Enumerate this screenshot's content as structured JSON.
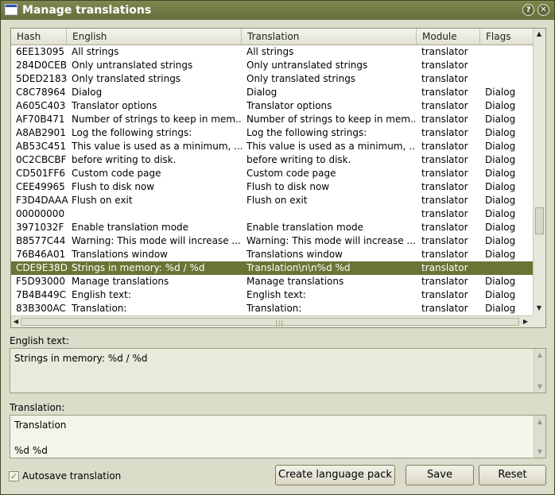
{
  "window": {
    "title": "Manage translations",
    "help_glyph": "?",
    "close_glyph": "✕"
  },
  "table": {
    "headers": [
      "Hash",
      "English",
      "Translation",
      "Module",
      "Flags"
    ],
    "rows": [
      {
        "hash": "6EE13095",
        "english": "All strings",
        "translation": "All strings",
        "module": "translator",
        "flags": ""
      },
      {
        "hash": "284D0CEB",
        "english": "Only untranslated strings",
        "translation": "Only untranslated strings",
        "module": "translator",
        "flags": ""
      },
      {
        "hash": "5DED2183",
        "english": "Only translated strings",
        "translation": "Only translated strings",
        "module": "translator",
        "flags": ""
      },
      {
        "hash": "C8C78964",
        "english": "Dialog",
        "translation": "Dialog",
        "module": "translator",
        "flags": "Dialog"
      },
      {
        "hash": "A605C403",
        "english": "Translator options",
        "translation": "Translator options",
        "module": "translator",
        "flags": "Dialog"
      },
      {
        "hash": "AF70B471",
        "english": "Number of strings to keep in mem...",
        "translation": "Number of strings to keep in mem...",
        "module": "translator",
        "flags": "Dialog"
      },
      {
        "hash": "A8AB2901",
        "english": "Log the following strings:",
        "translation": "Log the following strings:",
        "module": "translator",
        "flags": "Dialog"
      },
      {
        "hash": "AB53C451",
        "english": "This value is used as a minimum, ...",
        "translation": "This value is used as a minimum, ...",
        "module": "translator",
        "flags": "Dialog"
      },
      {
        "hash": "0C2CBCBF",
        "english": "before writing to disk.",
        "translation": "before writing to disk.",
        "module": "translator",
        "flags": "Dialog"
      },
      {
        "hash": "CD501FF6",
        "english": "Custom code page",
        "translation": "Custom code page",
        "module": "translator",
        "flags": "Dialog"
      },
      {
        "hash": "CEE49965",
        "english": "Flush to disk now",
        "translation": "Flush to disk now",
        "module": "translator",
        "flags": "Dialog"
      },
      {
        "hash": "F3D4DAAA",
        "english": "Flush on exit",
        "translation": "Flush on exit",
        "module": "translator",
        "flags": "Dialog"
      },
      {
        "hash": "00000000",
        "english": "",
        "translation": "",
        "module": "translator",
        "flags": "Dialog"
      },
      {
        "hash": "3971032F",
        "english": "Enable translation mode",
        "translation": "Enable translation mode",
        "module": "translator",
        "flags": "Dialog"
      },
      {
        "hash": "B8577C44",
        "english": "Warning: This mode will increase ...",
        "translation": "Warning: This mode will increase ...",
        "module": "translator",
        "flags": "Dialog"
      },
      {
        "hash": "76B46A01",
        "english": "Translations window",
        "translation": "Translations window",
        "module": "translator",
        "flags": "Dialog"
      },
      {
        "hash": "CDE9E38D",
        "english": "Strings in memory: %d / %d",
        "translation": "Translation\\n\\n%d %d",
        "module": "translator",
        "flags": "",
        "selected": true
      },
      {
        "hash": "F5D93000",
        "english": "Manage translations",
        "translation": "Manage translations",
        "module": "translator",
        "flags": "Dialog"
      },
      {
        "hash": "7B4B449C",
        "english": "English text:",
        "translation": "English text:",
        "module": "translator",
        "flags": "Dialog"
      },
      {
        "hash": "83B300AC",
        "english": "Translation:",
        "translation": "Translation:",
        "module": "translator",
        "flags": "Dialog"
      }
    ]
  },
  "english_text": {
    "label": "English text:",
    "value": "Strings in memory: %d / %d"
  },
  "translation": {
    "label": "Translation:",
    "value": "Translation\n\n%d %d"
  },
  "autosave": {
    "label": "Autosave translation",
    "checked": true
  },
  "buttons": {
    "create_language_pack": "Create language pack",
    "save": "Save",
    "reset": "Reset"
  },
  "colors": {
    "selection": "#6b7335",
    "titlebar": "#6d7541",
    "background": "#dcdccb"
  }
}
